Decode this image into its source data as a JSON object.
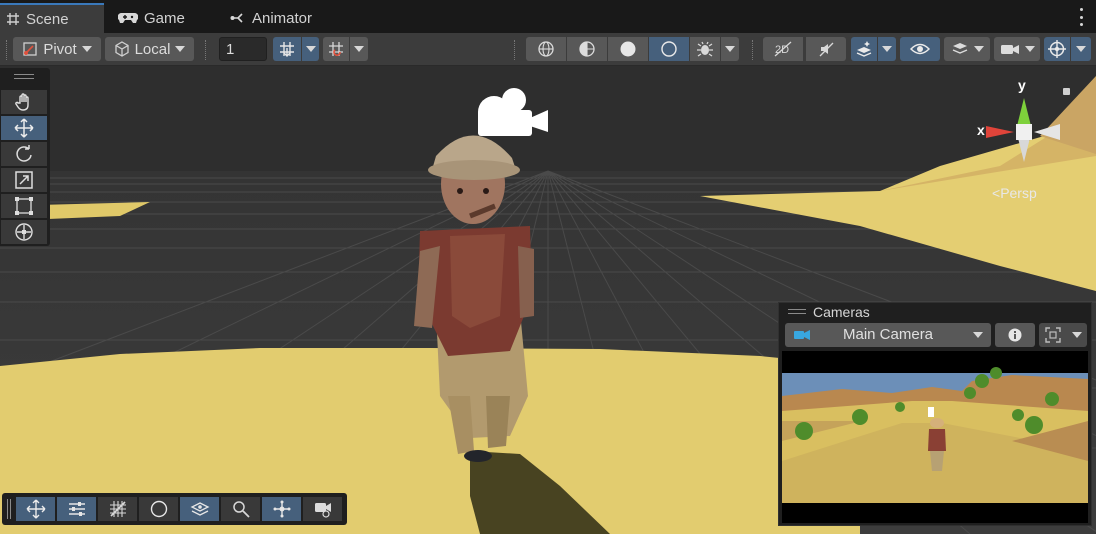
{
  "tabs": [
    {
      "label": "Scene",
      "icon": "grid-icon",
      "active": true
    },
    {
      "label": "Game",
      "icon": "gamepad-icon",
      "active": false
    },
    {
      "label": "Animator",
      "icon": "animator-icon",
      "active": false
    }
  ],
  "toolbar": {
    "pivot_label": "Pivot",
    "local_label": "Local",
    "grid_snap_value": "1"
  },
  "gizmo": {
    "x_label": "x",
    "y_label": "y",
    "projection_label": "Persp"
  },
  "cameras_overlay": {
    "title": "Cameras",
    "selected_camera": "Main Camera"
  },
  "colors": {
    "accent_blue": "#3a79bb",
    "selected_button": "#46607c",
    "ground_sand": "#e2cc6f",
    "axis_x": "#e0443a",
    "axis_y": "#7ed13b"
  }
}
